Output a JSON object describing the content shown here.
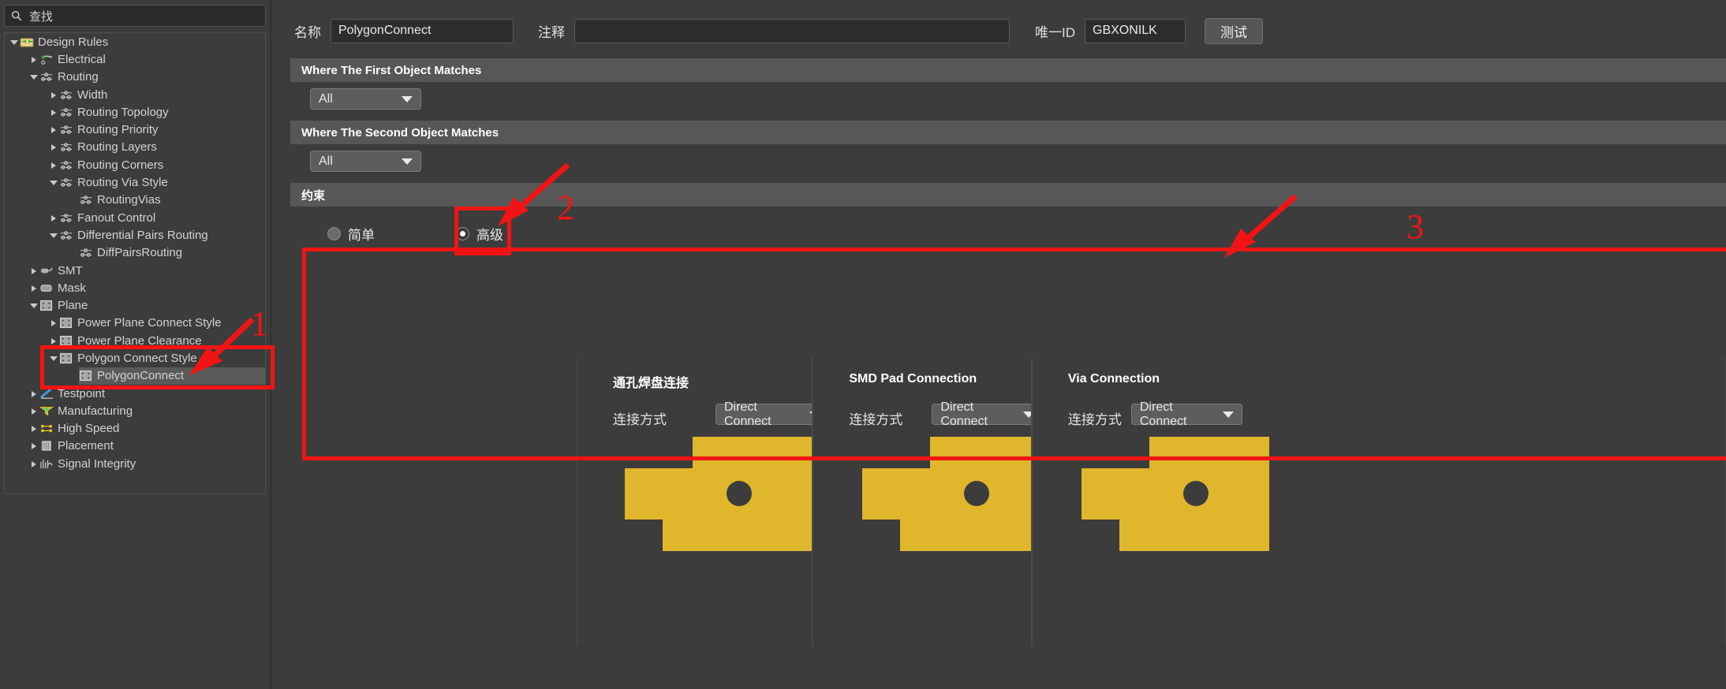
{
  "search": {
    "placeholder": "查找",
    "icon": "search-icon"
  },
  "tree": {
    "items": [
      {
        "label": "Design Rules",
        "depth": 0,
        "state": "expanded",
        "icon": "folder-rules-icon"
      },
      {
        "label": "Electrical",
        "depth": 1,
        "state": "collapsed",
        "icon": "electrical-icon"
      },
      {
        "label": "Routing",
        "depth": 1,
        "state": "expanded",
        "icon": "routing-icon"
      },
      {
        "label": "Width",
        "depth": 2,
        "state": "collapsed",
        "icon": "routing-icon"
      },
      {
        "label": "Routing Topology",
        "depth": 2,
        "state": "collapsed",
        "icon": "routing-icon"
      },
      {
        "label": "Routing Priority",
        "depth": 2,
        "state": "collapsed",
        "icon": "routing-icon"
      },
      {
        "label": "Routing Layers",
        "depth": 2,
        "state": "collapsed",
        "icon": "routing-icon"
      },
      {
        "label": "Routing Corners",
        "depth": 2,
        "state": "collapsed",
        "icon": "routing-icon"
      },
      {
        "label": "Routing Via Style",
        "depth": 2,
        "state": "expanded",
        "icon": "routing-icon"
      },
      {
        "label": "RoutingVias",
        "depth": 3,
        "state": "leaf",
        "icon": "routing-icon"
      },
      {
        "label": "Fanout Control",
        "depth": 2,
        "state": "collapsed",
        "icon": "routing-icon"
      },
      {
        "label": "Differential Pairs Routing",
        "depth": 2,
        "state": "expanded",
        "icon": "routing-icon"
      },
      {
        "label": "DiffPairsRouting",
        "depth": 3,
        "state": "leaf",
        "icon": "routing-icon"
      },
      {
        "label": "SMT",
        "depth": 1,
        "state": "collapsed",
        "icon": "smt-icon"
      },
      {
        "label": "Mask",
        "depth": 1,
        "state": "collapsed",
        "icon": "mask-icon"
      },
      {
        "label": "Plane",
        "depth": 1,
        "state": "expanded",
        "icon": "plane-icon"
      },
      {
        "label": "Power Plane Connect Style",
        "depth": 2,
        "state": "collapsed",
        "icon": "plane-icon"
      },
      {
        "label": "Power Plane Clearance",
        "depth": 2,
        "state": "collapsed",
        "icon": "plane-icon"
      },
      {
        "label": "Polygon Connect Style",
        "depth": 2,
        "state": "expanded",
        "icon": "plane-icon"
      },
      {
        "label": "PolygonConnect",
        "depth": 3,
        "state": "leaf",
        "icon": "plane-icon",
        "selected": true
      },
      {
        "label": "Testpoint",
        "depth": 1,
        "state": "collapsed",
        "icon": "testpoint-icon"
      },
      {
        "label": "Manufacturing",
        "depth": 1,
        "state": "collapsed",
        "icon": "manufacturing-icon"
      },
      {
        "label": "High Speed",
        "depth": 1,
        "state": "collapsed",
        "icon": "highspeed-icon"
      },
      {
        "label": "Placement",
        "depth": 1,
        "state": "collapsed",
        "icon": "placement-icon"
      },
      {
        "label": "Signal Integrity",
        "depth": 1,
        "state": "collapsed",
        "icon": "signal-integrity-icon"
      }
    ]
  },
  "form": {
    "name_label": "名称",
    "name_value": "PolygonConnect",
    "comment_label": "注释",
    "comment_value": "",
    "uid_label": "唯一ID",
    "uid_value": "GBXONILK",
    "test_button": "测试"
  },
  "sections": {
    "first_object": "Where The First Object Matches",
    "second_object": "Where The Second Object Matches",
    "constraints": "约束"
  },
  "scope": {
    "first_value": "All",
    "second_value": "All"
  },
  "constraint_mode": {
    "simple_label": "简单",
    "simple_selected": false,
    "advanced_label": "高级",
    "advanced_selected": true
  },
  "panels": [
    {
      "title": "通孔焊盘连接",
      "field_label": "连接方式",
      "field_value": "Direct Connect"
    },
    {
      "title": "SMD Pad Connection",
      "field_label": "连接方式",
      "field_value": "Direct Connect"
    },
    {
      "title": "Via Connection",
      "field_label": "连接方式",
      "field_value": "Direct Connect"
    }
  ],
  "annotations": {
    "markers": [
      "1",
      "2",
      "3"
    ],
    "color": "#f21414"
  },
  "colors": {
    "pad_fill": "#e0b62c",
    "background": "#3c3c3c",
    "section_header": "#575757",
    "selection": "#5a5a5a",
    "annotation": "#f21414"
  }
}
